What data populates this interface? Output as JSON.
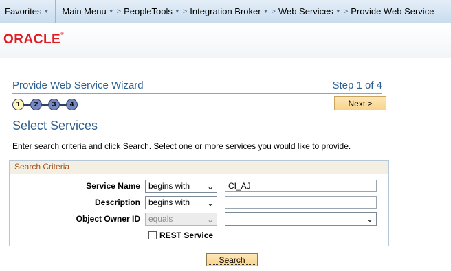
{
  "nav": {
    "favorites": "Favorites",
    "main_menu": "Main Menu",
    "breadcrumbs": [
      "PeopleTools",
      "Integration Broker",
      "Web Services",
      "Provide Web Service"
    ]
  },
  "brand": {
    "logo_text": "ORACLE",
    "logo_mark": "®"
  },
  "wizard": {
    "title": "Provide Web Service Wizard",
    "step_label": "Step 1 of 4",
    "steps": [
      "1",
      "2",
      "3",
      "4"
    ],
    "next_label": "Next >"
  },
  "page": {
    "title": "Select Services",
    "instructions": "Enter search criteria and click Search. Select one or more services you would like to provide."
  },
  "criteria": {
    "header": "Search Criteria",
    "service_name": {
      "label": "Service Name",
      "operator": "begins with",
      "value": "CI_AJ"
    },
    "description": {
      "label": "Description",
      "operator": "begins with",
      "value": ""
    },
    "object_owner": {
      "label": "Object Owner ID",
      "operator": "equals",
      "value": ""
    },
    "rest_service": {
      "label": "REST Service",
      "checked": false
    }
  },
  "search_label": "Search",
  "colors": {
    "accent": "#2c5f91",
    "logo": "#e01b22",
    "button": "#f9d48c"
  }
}
